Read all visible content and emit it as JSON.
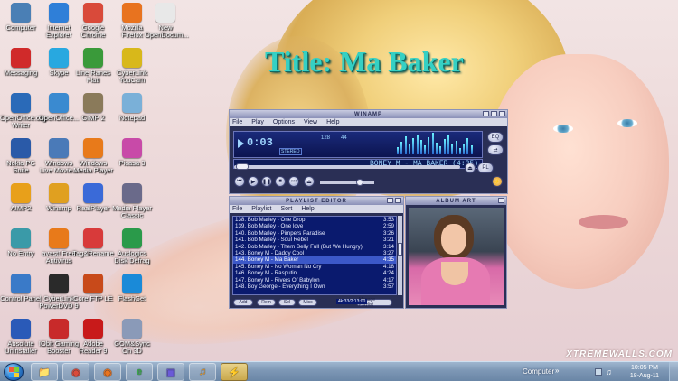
{
  "overlay_title": "Title: Ma Baker",
  "wallpaper_watermark": "XTREMEWALLS.COM",
  "desktop_icons": [
    {
      "label": "Computer",
      "icon": "computer-icon",
      "color": "#4a7fb5"
    },
    {
      "label": "Internet Explorer",
      "icon": "internet-explorer-icon",
      "color": "#2f7fd8"
    },
    {
      "label": "Google Chrome",
      "icon": "chrome-icon",
      "color": "#d94a3a"
    },
    {
      "label": "Mozilla Firefox",
      "icon": "firefox-icon",
      "color": "#e8731f"
    },
    {
      "label": "New OpenDocum...",
      "icon": "document-icon",
      "color": "#e8e8e8"
    },
    {
      "label": "Messaging",
      "icon": "messaging-icon",
      "color": "#d02a2a"
    },
    {
      "label": "Skype",
      "icon": "skype-icon",
      "color": "#28a8e0"
    },
    {
      "label": "Line Ranes Flati",
      "icon": "app-icon",
      "color": "#3a9a3a"
    },
    {
      "label": "CyberLink YouCam",
      "icon": "youcam-icon",
      "color": "#d8b81a"
    },
    {
      "label": "OpenOffice.org Writer",
      "icon": "writer-icon",
      "color": "#2a6ab8"
    },
    {
      "label": "OpenOffice...",
      "icon": "openoffice-icon",
      "color": "#3a8ad0"
    },
    {
      "label": "GIMP 2",
      "icon": "gimp-icon",
      "color": "#8a7a5a"
    },
    {
      "label": "Notepad",
      "icon": "notepad-icon",
      "color": "#7ab0d8"
    },
    {
      "label": "Nokia PC Suite",
      "icon": "nokia-icon",
      "color": "#2a5aa8"
    },
    {
      "label": "Windows Live Movie...",
      "icon": "movie-maker-icon",
      "color": "#4a7ab8"
    },
    {
      "label": "Windows Media Player",
      "icon": "media-player-icon",
      "color": "#e87a1a"
    },
    {
      "label": "Picasa 3",
      "icon": "picasa-icon",
      "color": "#c84aa8"
    },
    {
      "label": "AIMP2",
      "icon": "aimp-icon",
      "color": "#e8a01a"
    },
    {
      "label": "Winamp",
      "icon": "winamp-icon",
      "color": "#e0a020"
    },
    {
      "label": "RealPlayer",
      "icon": "realplayer-icon",
      "color": "#3a6ad8"
    },
    {
      "label": "Media Player Classic",
      "icon": "mpc-icon",
      "color": "#6a6a8a"
    },
    {
      "label": "No Entry",
      "icon": "no-entry-icon",
      "color": "#3a9aa8"
    },
    {
      "label": "avast! Free Antivirus",
      "icon": "avast-icon",
      "color": "#e87a1a"
    },
    {
      "label": "Tag&Rename",
      "icon": "tag-icon",
      "color": "#d83a3a"
    },
    {
      "label": "Auslogics Disk Defrag",
      "icon": "defrag-icon",
      "color": "#2a9a4a"
    },
    {
      "label": "Control Panel",
      "icon": "control-panel-icon",
      "color": "#3a7ac8"
    },
    {
      "label": "CyberLink PowerDVD 9",
      "icon": "powerdvd-icon",
      "color": "#2a2a2a"
    },
    {
      "label": "Core FTP LE",
      "icon": "ftp-icon",
      "color": "#c84a1a"
    },
    {
      "label": "FlashGet",
      "icon": "flashget-icon",
      "color": "#1a8ad8"
    },
    {
      "label": "Absolute Uninstaller",
      "icon": "uninstaller-icon",
      "color": "#2a5ab8"
    },
    {
      "label": "IObit Gaming Booster",
      "icon": "booster-icon",
      "color": "#c82a2a"
    },
    {
      "label": "Adobe Reader 9",
      "icon": "adobe-reader-icon",
      "color": "#c81a1a"
    },
    {
      "label": "GOM&Sync On 3D",
      "icon": "recycle-bin-icon",
      "color": "#8a9ab8"
    }
  ],
  "winamp": {
    "main_title": "WINAMP",
    "menu": [
      "File",
      "Play",
      "Options",
      "View",
      "Help"
    ],
    "time": "0:03",
    "marquee": "BONEY M - MA BAKER (4:35)",
    "kbps": "128",
    "khz": "44",
    "stereo": "STEREO",
    "playlist_title": "PLAYLIST EDITOR",
    "playlist_menu": [
      "File",
      "Playlist",
      "Sort",
      "Help"
    ],
    "album_art_title": "ALBUM ART",
    "current_index": 6,
    "playlist": [
      {
        "title": "138. Bob Marley - One Drop",
        "time": "3:53"
      },
      {
        "title": "139. Bob Marley - One love",
        "time": "2:59"
      },
      {
        "title": "140. Bob Marley - Pimpers Paradise",
        "time": "3:26"
      },
      {
        "title": "141. Bob Marley - Soul Rebel",
        "time": "3:21"
      },
      {
        "title": "142. Bob Marley - Them Belly Full (But We Hungry)",
        "time": "3:14"
      },
      {
        "title": "143. Boney M - Daddy Cool",
        "time": "3:27"
      },
      {
        "title": "144. Boney M - Ma Baker",
        "time": "4:35"
      },
      {
        "title": "145. Boney M - No Woman No Cry",
        "time": "4:18"
      },
      {
        "title": "146. Boney M - Rasputin",
        "time": "4:24"
      },
      {
        "title": "147. Boney M - Rivers Of Babylon",
        "time": "4:17"
      },
      {
        "title": "148. Boy George - Everything I Own",
        "time": "3:57"
      }
    ],
    "playlist_buttons": [
      "Add",
      "Rem",
      "Sel",
      "Misc",
      "Manage Playlist"
    ],
    "playlist_total": "4k:33/2:13:00"
  },
  "taskbar": {
    "items": [
      {
        "icon": "windows-explorer-icon",
        "color": "#e8a83a",
        "state": "run"
      },
      {
        "icon": "chrome-icon",
        "color": "#d94a3a",
        "state": "run"
      },
      {
        "icon": "firefox-icon",
        "color": "#e8731f",
        "state": "run"
      },
      {
        "icon": "ie-icon",
        "color": "#3aa84a",
        "state": "run"
      },
      {
        "icon": "paint-icon",
        "color": "#6a5ad8",
        "state": "run"
      },
      {
        "icon": "aimp-taskbar-icon",
        "color": "#e89a2a",
        "state": "run"
      },
      {
        "icon": "winamp-taskbar-icon",
        "color": "#e0b020",
        "state": "active"
      }
    ],
    "computer_label": "Computer",
    "clock_time": "10:05 PM",
    "clock_date": "18-Aug-11"
  }
}
